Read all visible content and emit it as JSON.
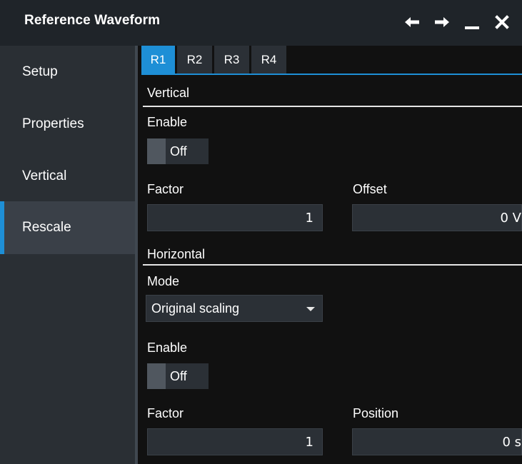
{
  "window": {
    "title": "Reference Waveform",
    "icons": [
      "arrow-left-icon",
      "arrow-right-icon",
      "minimize-icon",
      "close-icon"
    ]
  },
  "sidebar": {
    "items": [
      {
        "label": "Setup"
      },
      {
        "label": "Properties"
      },
      {
        "label": "Vertical"
      },
      {
        "label": "Rescale",
        "active": true
      }
    ]
  },
  "tabs": [
    {
      "label": "R1",
      "active": true
    },
    {
      "label": "R2"
    },
    {
      "label": "R3"
    },
    {
      "label": "R4"
    }
  ],
  "vertical": {
    "section_title": "Vertical",
    "enable_label": "Enable",
    "enable_state": "Off",
    "factor_label": "Factor",
    "factor_value": "1",
    "offset_label": "Offset",
    "offset_value": "0 V"
  },
  "horizontal": {
    "section_title": "Horizontal",
    "mode_label": "Mode",
    "mode_value": "Original scaling",
    "enable_label": "Enable",
    "enable_state": "Off",
    "factor_label": "Factor",
    "factor_value": "1",
    "position_label": "Position",
    "position_value": "0 s"
  },
  "colors": {
    "accent": "#1e8fd6",
    "titlebar_bg": "#1f2429",
    "sidebar_bg": "#2a2f34",
    "control_bg": "#2b3036",
    "content_bg": "#111111"
  }
}
